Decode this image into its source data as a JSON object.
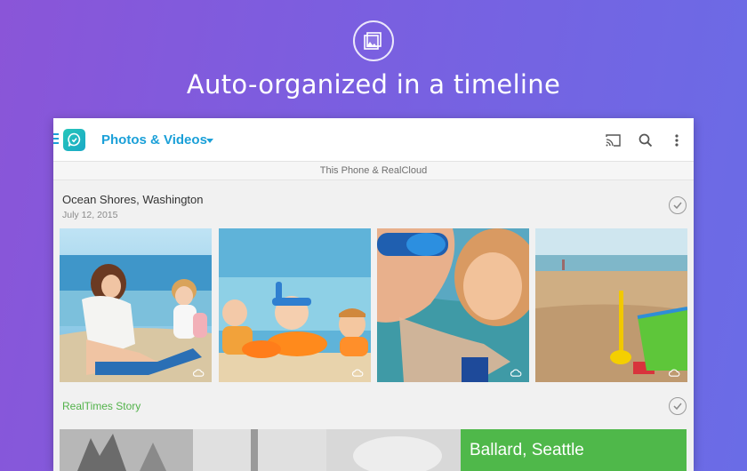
{
  "promo": {
    "headline": "Auto-organized in a timeline",
    "icon": "photos-icon"
  },
  "app": {
    "title": "Photos & Videos",
    "source": "This Phone & RealCloud",
    "icons": [
      "menu-icon",
      "realplayer-logo",
      "cast-icon",
      "search-icon",
      "more-vert-icon"
    ],
    "accent_color": "#1ba0d8"
  },
  "album": {
    "title": "Ocean Shores, Washington",
    "date": "July 12, 2015",
    "photos": [
      {
        "subject": "mother-and-child-on-beach"
      },
      {
        "subject": "kids-lying-on-sand"
      },
      {
        "subject": "child-with-goggles-in-water"
      },
      {
        "subject": "sand-toys-on-beach"
      }
    ]
  },
  "story": {
    "title": "RealTimes Story",
    "banner": "Ballard, Seattle",
    "accent_color": "#4fb84a"
  }
}
